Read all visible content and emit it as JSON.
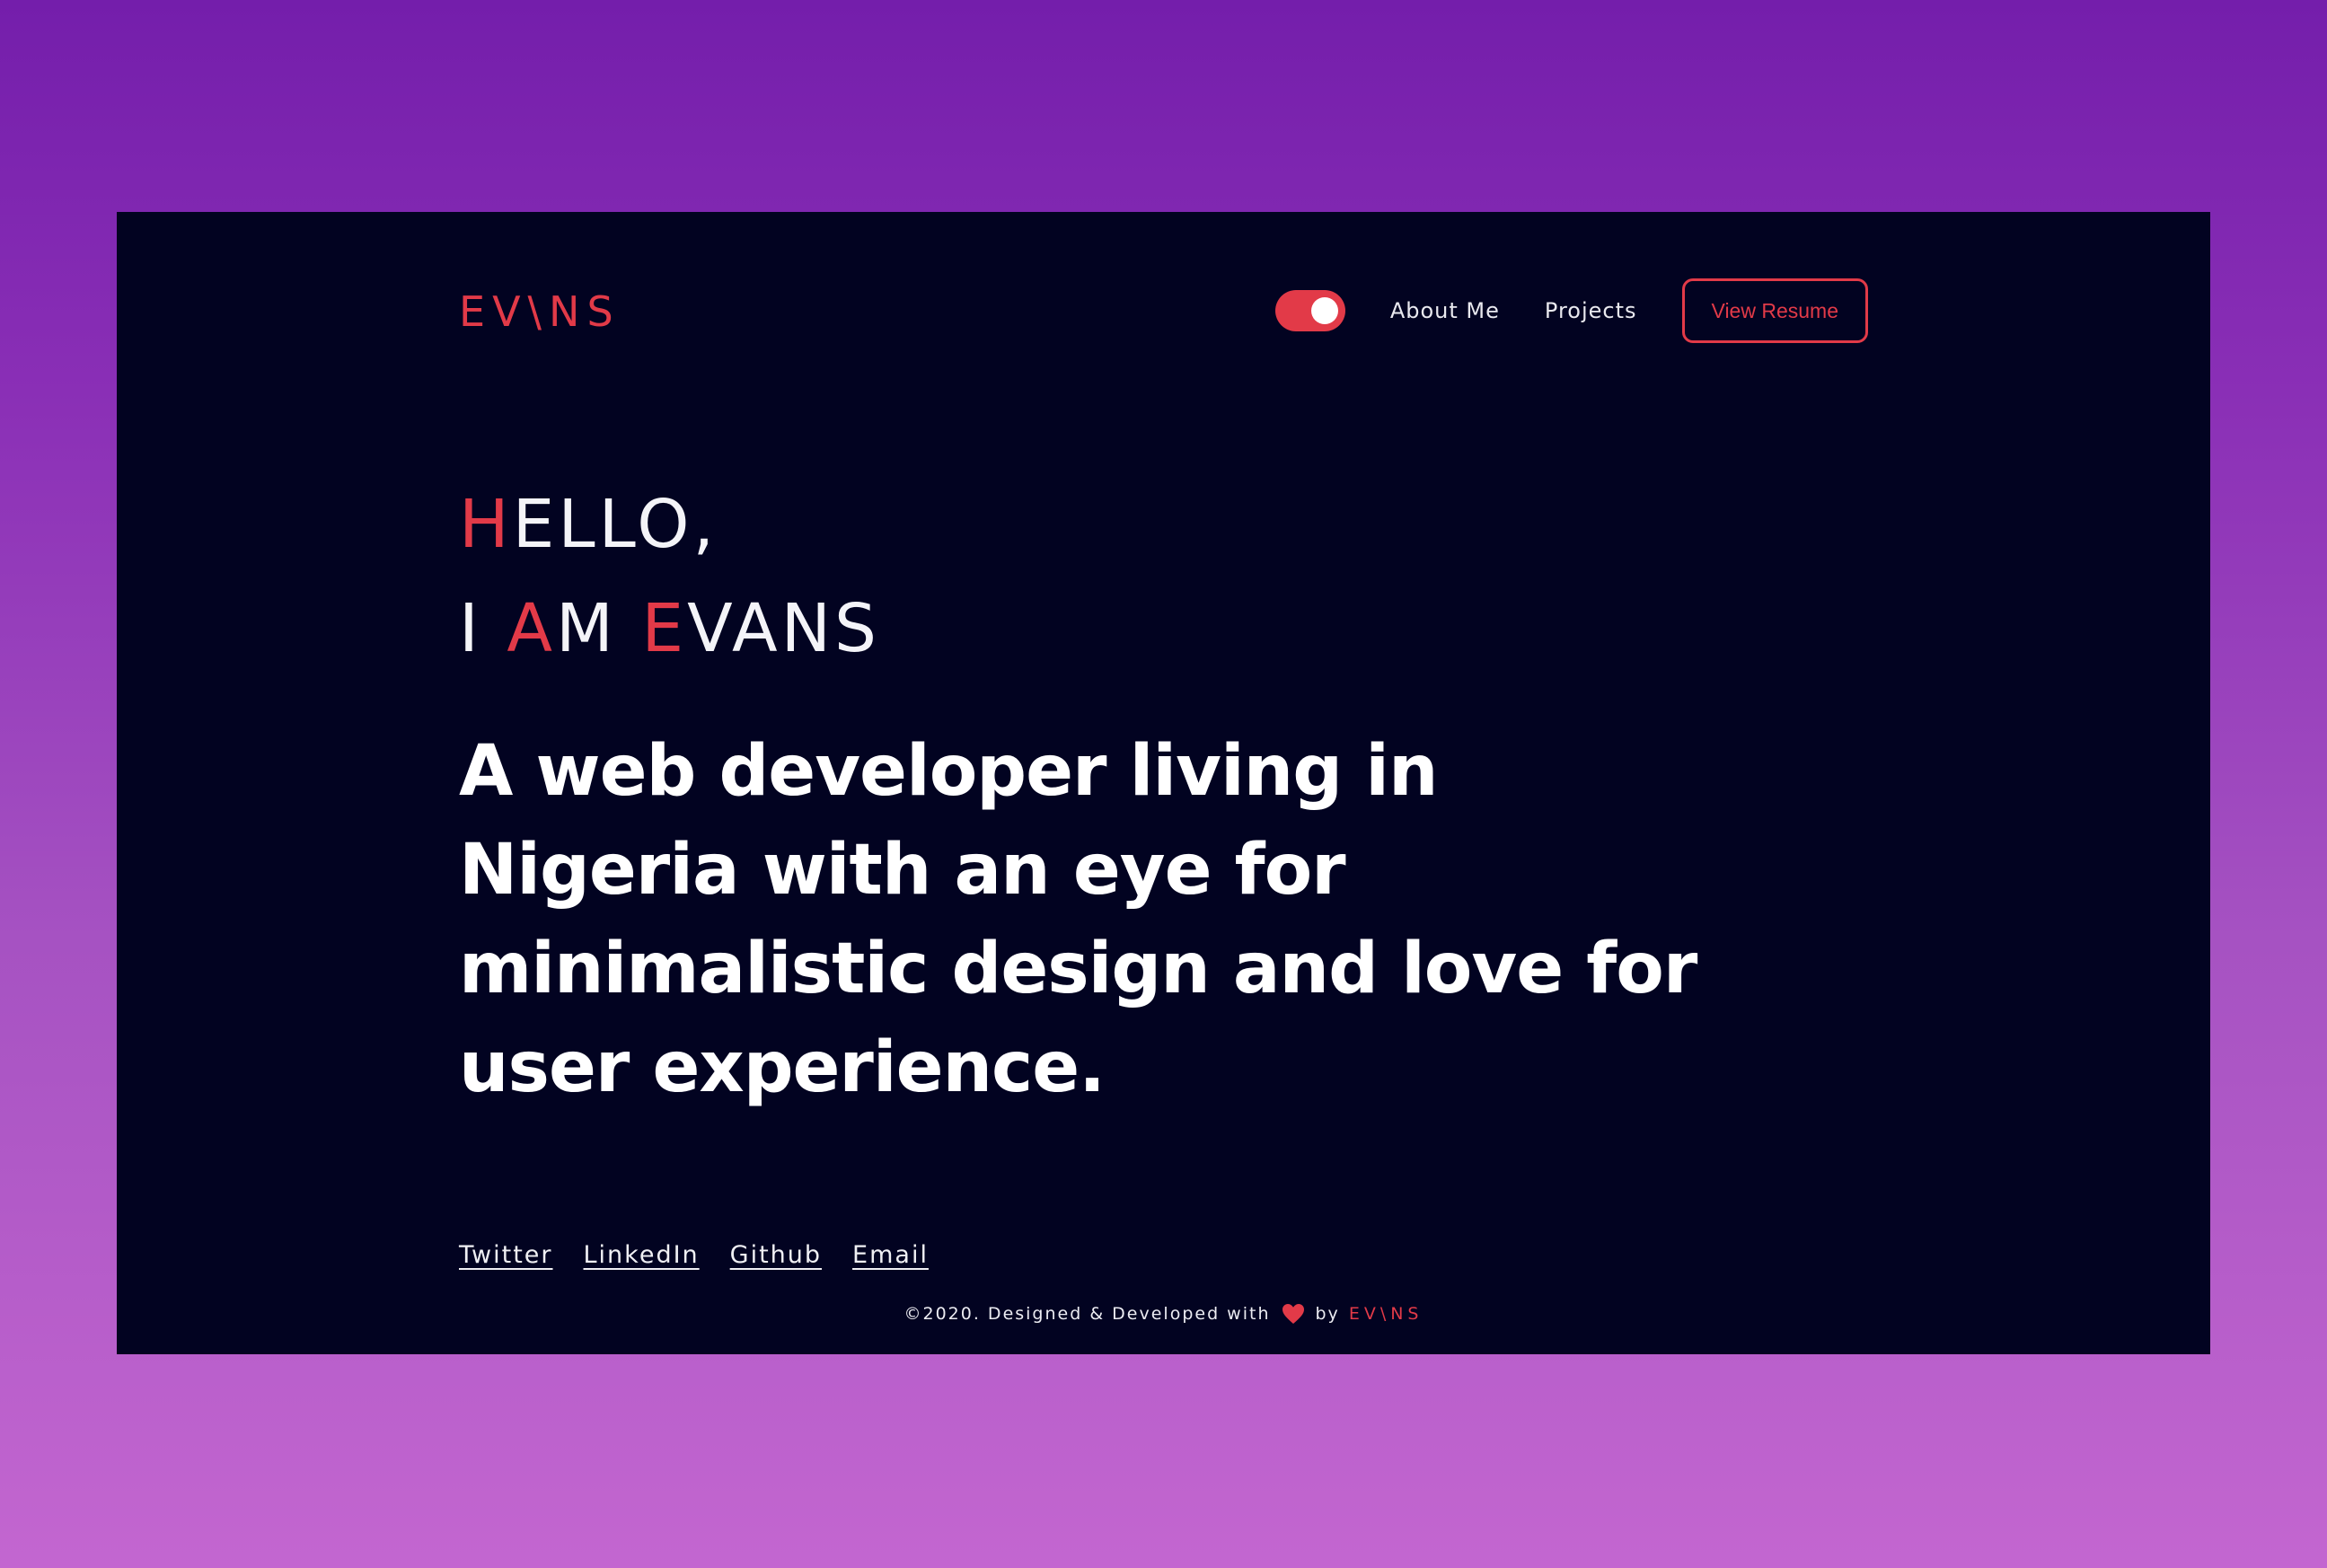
{
  "brand": {
    "logo": "EV\\NS",
    "accent_color": "#e23a48",
    "background_color": "#020321"
  },
  "nav": {
    "theme_toggle": "on",
    "links": [
      "About Me",
      "Projects"
    ],
    "resume_button": "View Resume"
  },
  "hero": {
    "line1_accent": "H",
    "line1_rest": "ELLO,",
    "line2_part1": "I ",
    "line2_accent1": "A",
    "line2_part2": "M ",
    "line2_accent2": "E",
    "line2_part3": "VANS",
    "tagline": "A web developer living in Nigeria with an eye for minimalistic design and love for user experience."
  },
  "socials": [
    "Twitter",
    "LinkedIn",
    "Github",
    "Email"
  ],
  "footer": {
    "text": "©2020. Designed & Developed with",
    "icon": "heart-icon",
    "by": "by",
    "brand": "EV\\NS"
  }
}
